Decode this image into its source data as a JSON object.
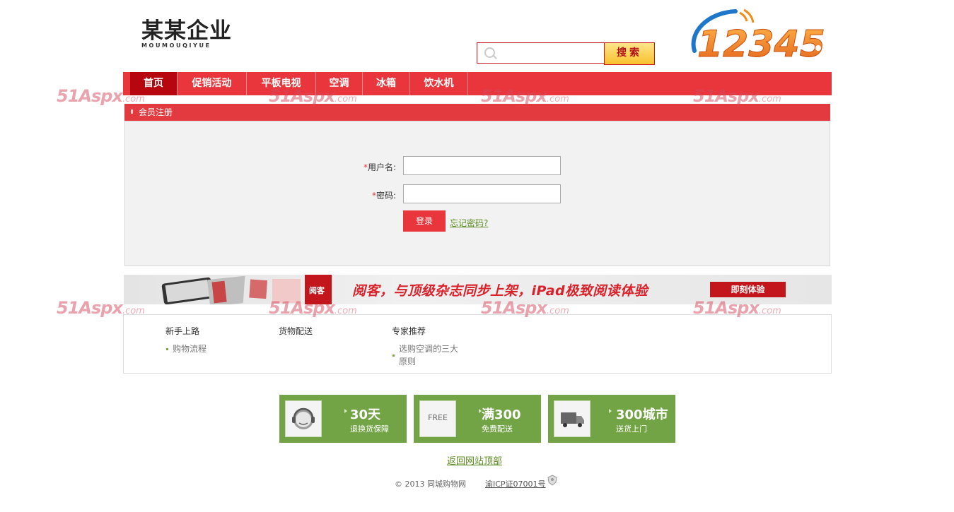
{
  "header": {
    "logo_main": "某某企业",
    "logo_sub": "MOUMOUQIYUE",
    "search_button": "搜索",
    "hotline_logo_text": "12345"
  },
  "nav": {
    "items": [
      {
        "label": "首页",
        "active": true
      },
      {
        "label": "促销活动",
        "active": false
      },
      {
        "label": "平板电视",
        "active": false
      },
      {
        "label": "空调",
        "active": false
      },
      {
        "label": "冰箱",
        "active": false
      },
      {
        "label": "饮水机",
        "active": false
      }
    ]
  },
  "register": {
    "title": "会员注册",
    "username_label": "用户名:",
    "password_label": "密码:",
    "required_mark": "*",
    "login_button": "登录",
    "forgot_link": "忘记密码?"
  },
  "banner": {
    "text": "阅客，与顶级杂志同步上架，iPad极致阅读体验",
    "button": "即刻体验",
    "tag": "阅客"
  },
  "footer_columns": [
    {
      "title": "新手上路",
      "links": [
        "购物流程"
      ]
    },
    {
      "title": "货物配送",
      "links": []
    },
    {
      "title": "专家推荐",
      "links": [
        "选购空调的三大",
        "原则"
      ]
    }
  ],
  "services": [
    {
      "big": "30天",
      "small": "退换货保障",
      "icon": "headset-icon",
      "icon_text": ""
    },
    {
      "big": "满300",
      "small": "免费配送",
      "icon": "free-tag-icon",
      "icon_text": "FREE"
    },
    {
      "big": "300城市",
      "small": "送货上门",
      "icon": "truck-icon",
      "icon_text": ""
    }
  ],
  "footer": {
    "back_to_top": "返回网站顶部",
    "copyright": "© 2013  同城购物网",
    "icp": "渝ICP证07001号"
  },
  "watermark": {
    "text": "51Aspx",
    "suffix": ".com"
  },
  "colors": {
    "nav_red": "#e8363c",
    "nav_active": "#b5070d",
    "service_green": "#72a344",
    "link_green": "#5a8b1e"
  }
}
